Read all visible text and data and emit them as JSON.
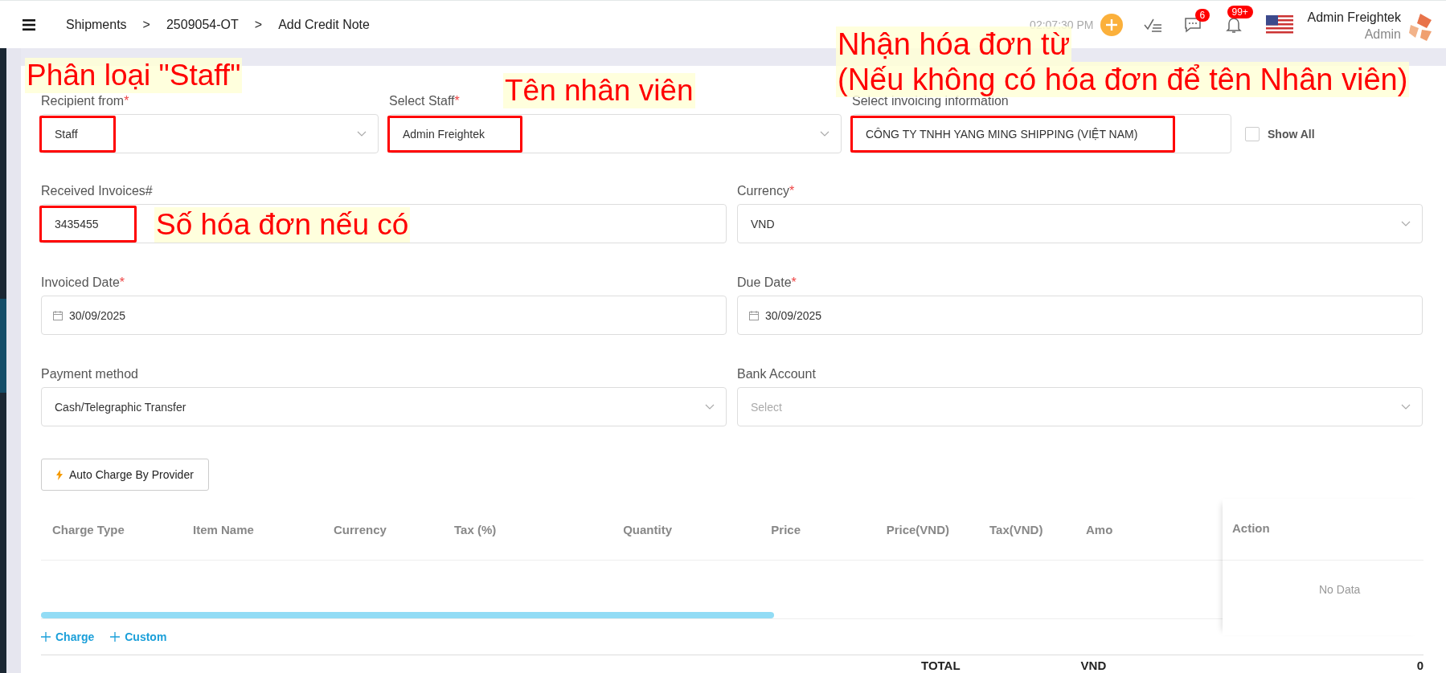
{
  "topbar": {
    "breadcrumb": [
      {
        "label": "Shipments"
      },
      {
        "label": "2509054-OT"
      },
      {
        "label": "Add Credit Note"
      }
    ],
    "separator": ">",
    "time": "02:07:30 PM",
    "chat_badge": "6",
    "bell_badge": "99+",
    "user_name": "Admin Freightek",
    "user_role": "Admin"
  },
  "rows": [
    [
      {
        "label": "Recipient from",
        "required": true,
        "kind": "select",
        "value": "Staff",
        "highlighted": true
      },
      {
        "label": "Select Staff",
        "required": true,
        "kind": "select",
        "value": "Admin Freightek",
        "highlighted": true
      },
      {
        "label": "Select invoicing information",
        "required": false,
        "kind": "input",
        "value": "CÔNG TY TNHH YANG MING SHIPPING (VIỆT NAM)",
        "highlighted": true
      }
    ],
    [
      {
        "label": "Received Invoices#",
        "required": false,
        "kind": "input",
        "value": "3435455",
        "highlighted": true
      },
      {
        "label": "Currency",
        "required": true,
        "kind": "select",
        "value": "VND",
        "highlighted": false
      }
    ],
    [
      {
        "label": "Invoiced Date",
        "required": true,
        "kind": "date",
        "value": "30/09/2025",
        "highlighted": false
      },
      {
        "label": "Due Date",
        "required": true,
        "kind": "date",
        "value": "30/09/2025",
        "highlighted": false
      }
    ],
    [
      {
        "label": "Payment method",
        "required": false,
        "kind": "select",
        "value": "Cash/Telegraphic Transfer",
        "highlighted": false
      },
      {
        "label": "Bank Account",
        "required": false,
        "kind": "select",
        "placeholder": "Select",
        "highlighted": false
      }
    ]
  ],
  "required_mark": "*",
  "show_all": {
    "label": "Show All",
    "checked": false
  },
  "auto_button": "Auto Charge By Provider",
  "table": {
    "columns": [
      "Charge Type",
      "Item Name",
      "Currency",
      "Tax (%)",
      "Quantity",
      "Price",
      "Price(VND)",
      "Tax(VND)",
      "Amo"
    ],
    "action_column": "Action",
    "empty_text": "No Data"
  },
  "add_links": [
    {
      "label": "Charge"
    },
    {
      "label": "Custom"
    }
  ],
  "totals": {
    "label": "TOTAL",
    "currency": "VND",
    "amount": "0"
  },
  "annotations": [
    {
      "lines": [
        "Phân loại \"Staff\""
      ]
    },
    {
      "lines": [
        "Tên nhân viên"
      ]
    },
    {
      "lines": [
        "Nhận hóa đơn từ",
        "(Nếu không có hóa đơn để tên Nhân viên)"
      ]
    },
    {
      "lines": [
        "Số hóa đơn nếu có"
      ]
    }
  ]
}
